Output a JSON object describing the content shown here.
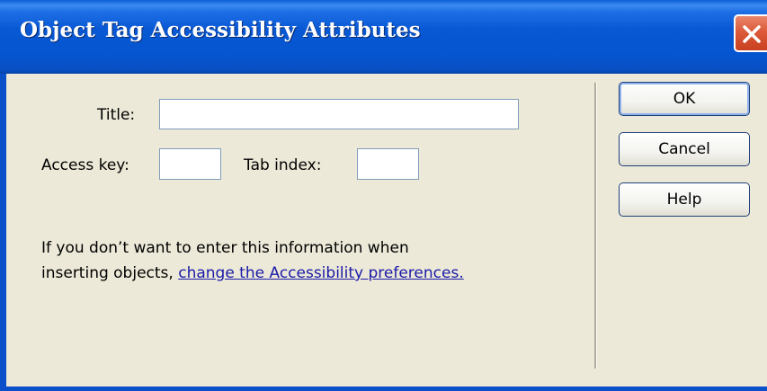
{
  "dialog": {
    "title": "Object Tag Accessibility Attributes"
  },
  "form": {
    "title_label": "Title:",
    "title_value": "",
    "access_key_label": "Access key:",
    "access_key_value": "",
    "tab_index_label": "Tab index:",
    "tab_index_value": ""
  },
  "info": {
    "text_line1": "If you don’t want to enter this information when",
    "text_line2": "inserting objects, ",
    "link_text": "change the Accessibility preferences."
  },
  "buttons": {
    "ok": "OK",
    "cancel": "Cancel",
    "help": "Help"
  },
  "icons": {
    "close": "close-icon"
  },
  "colors": {
    "titlebar": "#0455cf",
    "close_button": "#dc5a3a",
    "link": "#1a1aa8",
    "dialog_bg": "#ece9d8"
  }
}
